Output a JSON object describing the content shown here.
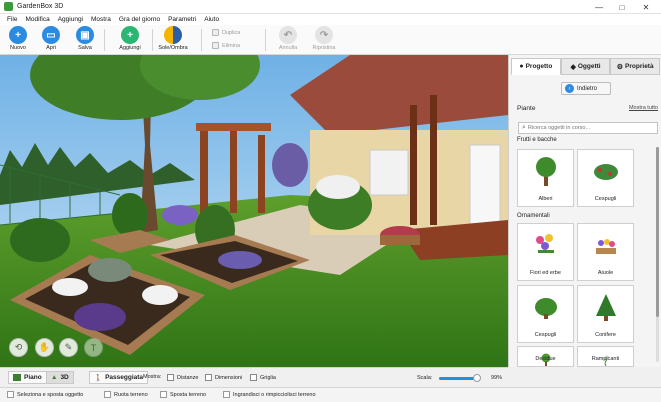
{
  "window": {
    "title": "GardenBox 3D",
    "minimize": "—",
    "maximize": "□",
    "close": "✕"
  },
  "menu": [
    "File",
    "Modifica",
    "Aggiungi",
    "Mostra",
    "Gra del giorno",
    "Parametri",
    "Aiuto"
  ],
  "toolbar": {
    "new": "Nuovo",
    "open": "Apri",
    "save": "Salva",
    "add": "Aggiungi",
    "sun_shade": "Sole/Ombra",
    "duplicate": "Duplica",
    "delete": "Elimina",
    "undo": "Annulla",
    "redo": "Ripristina"
  },
  "tabs": [
    {
      "label": "Progetto",
      "icon": "globe-icon"
    },
    {
      "label": "Oggetti",
      "icon": "layers-icon"
    },
    {
      "label": "Proprietà",
      "icon": "gear-icon"
    }
  ],
  "panel": {
    "back": "Indietro",
    "title": "Piante",
    "show_all": "Mostra tutto",
    "search_placeholder": "Ricerca oggetti in corso...",
    "sections": [
      {
        "name": "Frutti e bacche",
        "items": [
          "Alberi",
          "Cespugli"
        ]
      },
      {
        "name": "Ornamentali",
        "items": [
          "Fiori ed erbe",
          "Aiuole",
          "Cespugli",
          "Conifere",
          "Decidue",
          "Rampicanti"
        ]
      }
    ]
  },
  "viewbar": {
    "plan": "Piano",
    "view3d": "3D",
    "walk": "Passeggiata",
    "show": "Mostra:",
    "distances": "Distanze",
    "dimensions": "Dimensioni",
    "grid": "Griglia",
    "scale_label": "Scala:",
    "scale_value": "99%",
    "scale_fraction": 0.99
  },
  "status": [
    "Seleziona e sposta oggetto",
    "Ruota terreno",
    "Sposta terreno",
    "Ingrandisci o rimpicciolisci terreno"
  ],
  "colors": {
    "accent": "#2a8be0",
    "grass": "#3d8a1f",
    "sky": "#8cc4ea",
    "add_green": "#2bb673"
  }
}
